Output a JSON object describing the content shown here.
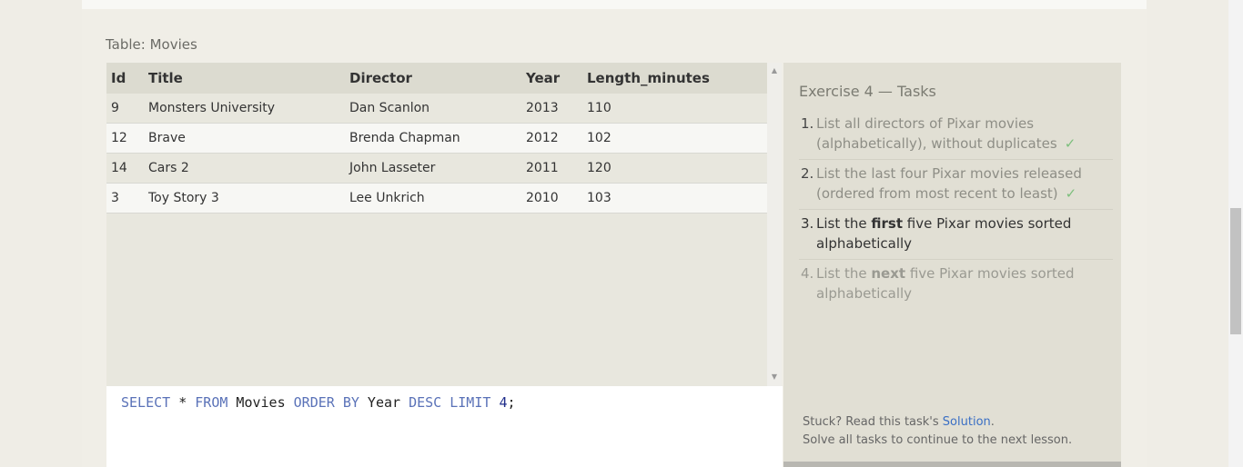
{
  "table": {
    "caption": "Table: Movies",
    "columns": [
      "Id",
      "Title",
      "Director",
      "Year",
      "Length_minutes"
    ],
    "rows": [
      [
        "9",
        "Monsters University",
        "Dan Scanlon",
        "2013",
        "110"
      ],
      [
        "12",
        "Brave",
        "Brenda Chapman",
        "2012",
        "102"
      ],
      [
        "14",
        "Cars 2",
        "John Lasseter",
        "2011",
        "120"
      ],
      [
        "3",
        "Toy Story 3",
        "Lee Unkrich",
        "2010",
        "103"
      ]
    ]
  },
  "editor": {
    "tokens": [
      {
        "t": "SELECT",
        "c": "kw"
      },
      {
        "t": " * ",
        "c": "op"
      },
      {
        "t": "FROM",
        "c": "kw"
      },
      {
        "t": " Movies ",
        "c": "id"
      },
      {
        "t": "ORDER BY",
        "c": "kw"
      },
      {
        "t": " Year ",
        "c": "id"
      },
      {
        "t": "DESC",
        "c": "kw"
      },
      {
        "t": " ",
        "c": "op"
      },
      {
        "t": "LIMIT",
        "c": "kw"
      },
      {
        "t": " ",
        "c": "op"
      },
      {
        "t": "4",
        "c": "num"
      },
      {
        "t": ";",
        "c": "op"
      }
    ]
  },
  "tasks": {
    "title": "Exercise 4 — Tasks",
    "items": [
      {
        "num": "1.",
        "pre": "List all directors of Pixar movies (alphabetically), without duplicates",
        "bold": "",
        "post": "",
        "state": "done",
        "check": "✓"
      },
      {
        "num": "2.",
        "pre": "List the last four Pixar movies released (ordered from most recent to least)",
        "bold": "",
        "post": "",
        "state": "done",
        "check": "✓"
      },
      {
        "num": "3.",
        "pre": "List the ",
        "bold": "first",
        "post": " five Pixar movies sorted alphabetically",
        "state": "current",
        "check": ""
      },
      {
        "num": "4.",
        "pre": "List the ",
        "bold": "next",
        "post": " five Pixar movies sorted alphabetically",
        "state": "future",
        "check": ""
      }
    ],
    "stuck_prefix": "Stuck? Read this task's ",
    "solution_link": "Solution",
    "stuck_suffix": ".",
    "continue_text": "Solve all tasks to continue to the next lesson."
  },
  "colors": {
    "keyword": "#5a72b8",
    "check": "#7cbf7c",
    "link": "#3a6fc4"
  }
}
